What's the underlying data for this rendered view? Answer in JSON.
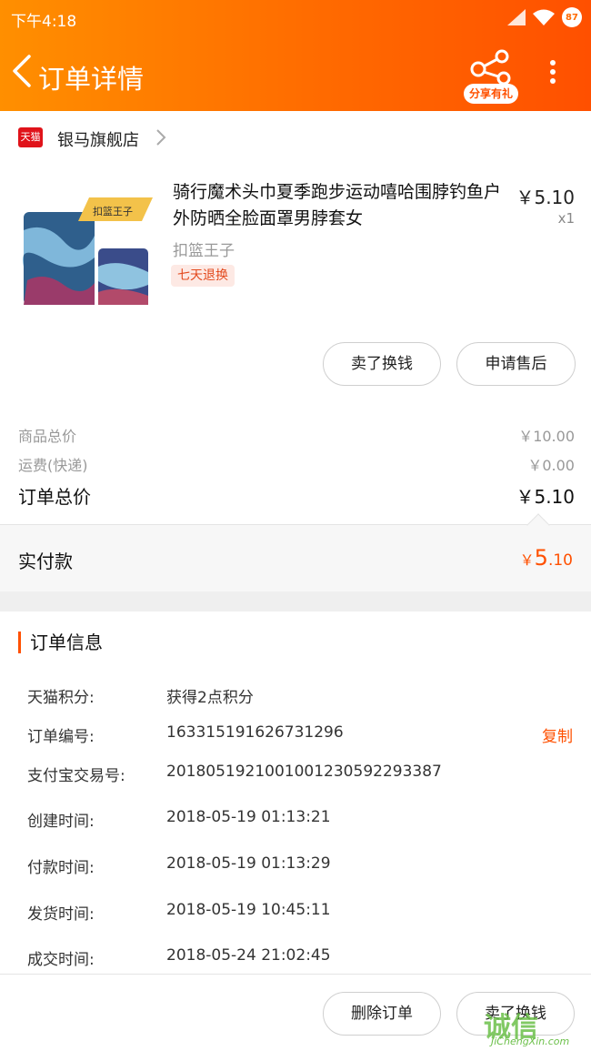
{
  "status_bar": {
    "time": "下午4:18",
    "battery": "87"
  },
  "nav": {
    "title": "订单详情",
    "share_label": "分享有礼"
  },
  "shop": {
    "badge": "天猫",
    "name": "银马旗舰店"
  },
  "product": {
    "image_label": "扣篮王子",
    "title": "骑行魔术头巾夏季跑步运动嘻哈围脖钓鱼户外防晒全脸面罩男脖套女",
    "price": "￥5.10",
    "quantity": "x1",
    "spec": "扣篮王子",
    "tag": "七天退换"
  },
  "product_actions": {
    "sell_label": "卖了换钱",
    "aftersale_label": "申请售后"
  },
  "summary": {
    "goods_total_label": "商品总价",
    "goods_total_value": "￥10.00",
    "shipping_label": "运费(快递)",
    "shipping_value": "￥0.00",
    "order_total_label": "订单总价",
    "order_total_value": "￥5.10",
    "paid_label": "实付款",
    "paid_symbol": "￥",
    "paid_int": "5",
    "paid_dec": ".10"
  },
  "order_info": {
    "title": "订单信息",
    "copy_label": "复制",
    "rows": [
      {
        "key": "天猫积分:",
        "value": "获得2点积分"
      },
      {
        "key": "订单编号:",
        "value": "163315191626731296"
      },
      {
        "key": "支付宝交易号:",
        "value": "2018051921001001230592293387"
      },
      {
        "key": "创建时间:",
        "value": "2018-05-19 01:13:21"
      },
      {
        "key": "付款时间:",
        "value": "2018-05-19 01:13:29"
      },
      {
        "key": "发货时间:",
        "value": "2018-05-19 10:45:11"
      },
      {
        "key": "成交时间:",
        "value": "2018-05-24 21:02:45"
      }
    ]
  },
  "bottom_actions": {
    "delete_label": "删除订单",
    "sell_label": "卖了换钱"
  },
  "watermark": {
    "main": "诚信",
    "sub": "JiChengXin.com"
  },
  "colors": {
    "accent": "#ff5000",
    "header_start": "#ff8f00",
    "tag_bg": "#fde9e4"
  }
}
